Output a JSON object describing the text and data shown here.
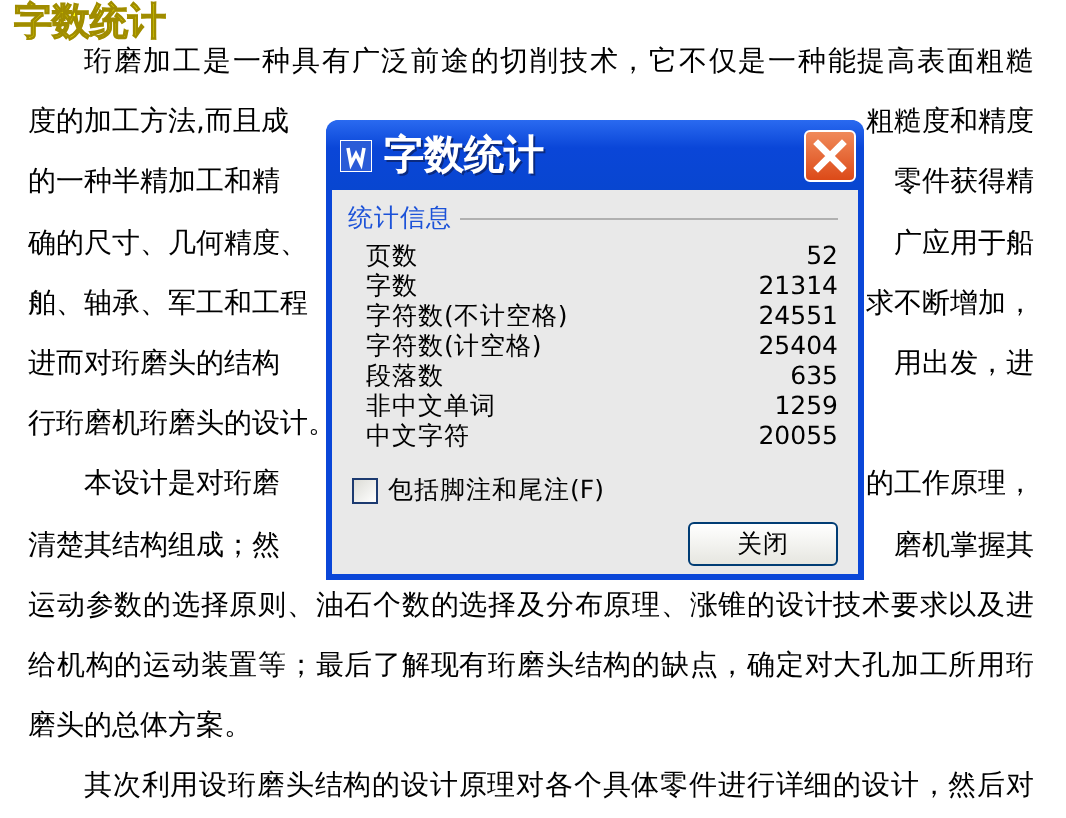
{
  "caption": "字数统计",
  "document": {
    "lines": [
      {
        "left": "珩磨加工是一种具有广泛前途的切削技术，它不仅是一种能提高表面粗糙",
        "indent": true
      },
      {
        "left": "度的加工方法,而且成",
        "right": "粗糙度和精度",
        "indent": false
      },
      {
        "left": "的一种半精加工和精",
        "right": "零件获得精",
        "indent": false
      },
      {
        "left": "确的尺寸、几何精度、",
        "right": "广应用于船",
        "indent": false
      },
      {
        "left": "舶、轴承、军工和工程",
        "right": "求不断增加，",
        "indent": false
      },
      {
        "left": "进而对珩磨头的结构",
        "right": "用出发，进",
        "indent": false
      },
      {
        "left": "行珩磨机珩磨头的设计。",
        "indent": false
      },
      {
        "left": "本设计是对珩磨",
        "right": "的工作原理，",
        "indent": true
      },
      {
        "left": "清楚其结构组成；然",
        "right": "磨机掌握其",
        "indent": false
      },
      {
        "left": "运动参数的选择原则、油石个数的选择及分布原理、涨锥的设计技术要求以及进",
        "indent": false
      },
      {
        "left": "给机构的运动装置等；最后了解现有珩磨头结构的缺点，确定对大孔加工所用珩",
        "indent": false
      },
      {
        "left": "磨头的总体方案。",
        "indent": false
      },
      {
        "left": "其次利用设珩磨头结构的设计原理对各个具体零件进行详细的设计，然后对",
        "indent": true
      }
    ]
  },
  "dialog": {
    "title": "字数统计",
    "group_label": "统计信息",
    "stats": [
      {
        "label": "页数",
        "value": "52"
      },
      {
        "label": "字数",
        "value": "21314"
      },
      {
        "label": "字符数(不计空格)",
        "value": "24551"
      },
      {
        "label": "字符数(计空格)",
        "value": "25404"
      },
      {
        "label": "段落数",
        "value": "635"
      },
      {
        "label": "非中文单词",
        "value": "1259"
      },
      {
        "label": "中文字符",
        "value": "20055"
      }
    ],
    "checkbox": {
      "label": "包括脚注和尾注(F)",
      "checked": false
    },
    "button": "关闭"
  }
}
